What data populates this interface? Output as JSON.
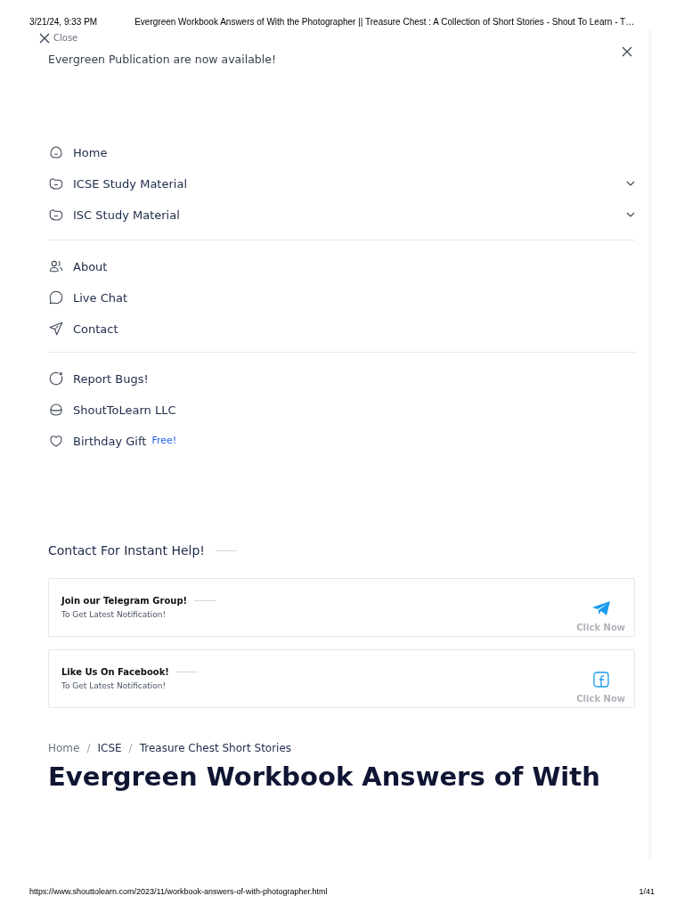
{
  "print_header": {
    "date": "3/21/24, 9:33 PM",
    "title": "Evergreen Workbook Answers of With the Photographer || Treasure Chest : A Collection of Short Stories - Shout To Learn - T…"
  },
  "close_link": "Close",
  "notice": {
    "text": "Evergreen Publication are now available!"
  },
  "menu_groups": [
    {
      "items": [
        {
          "label": "Home",
          "submenu": false
        },
        {
          "label": "ICSE Study Material",
          "submenu": true
        },
        {
          "label": "ISC Study Material",
          "submenu": true
        }
      ]
    },
    {
      "items": [
        {
          "label": "About",
          "submenu": false
        },
        {
          "label": "Live Chat",
          "submenu": false
        },
        {
          "label": "Contact",
          "submenu": false
        }
      ]
    },
    {
      "items": [
        {
          "label": "Report Bugs!",
          "submenu": false
        },
        {
          "label": "ShoutToLearn LLC",
          "submenu": false
        },
        {
          "label": "Birthday Gift",
          "submenu": false,
          "badge": "Free!"
        }
      ]
    }
  ],
  "help": {
    "title": "Contact For Instant Help!",
    "cards": [
      {
        "kind": "telegram",
        "title": "Join our Telegram Group!",
        "subtitle": "To Get Latest Notification!",
        "action": "Click Now"
      },
      {
        "kind": "facebook",
        "title": "Like Us On Facebook!",
        "subtitle": "To Get Latest Notification!",
        "action": "Click Now"
      }
    ]
  },
  "breadcrumb": [
    {
      "label": "Home",
      "muted": true
    },
    {
      "separator": "/",
      "label": "ICSE",
      "muted": false
    },
    {
      "separator": "/",
      "label": "Treasure Chest Short Stories",
      "muted": false
    }
  ],
  "heading": "Evergreen Workbook Answers of With",
  "print_footer": {
    "url": "https://www.shouttolearn.com/2023/11/workbook-answers-of-with-photographer.html",
    "page": "1/41"
  }
}
